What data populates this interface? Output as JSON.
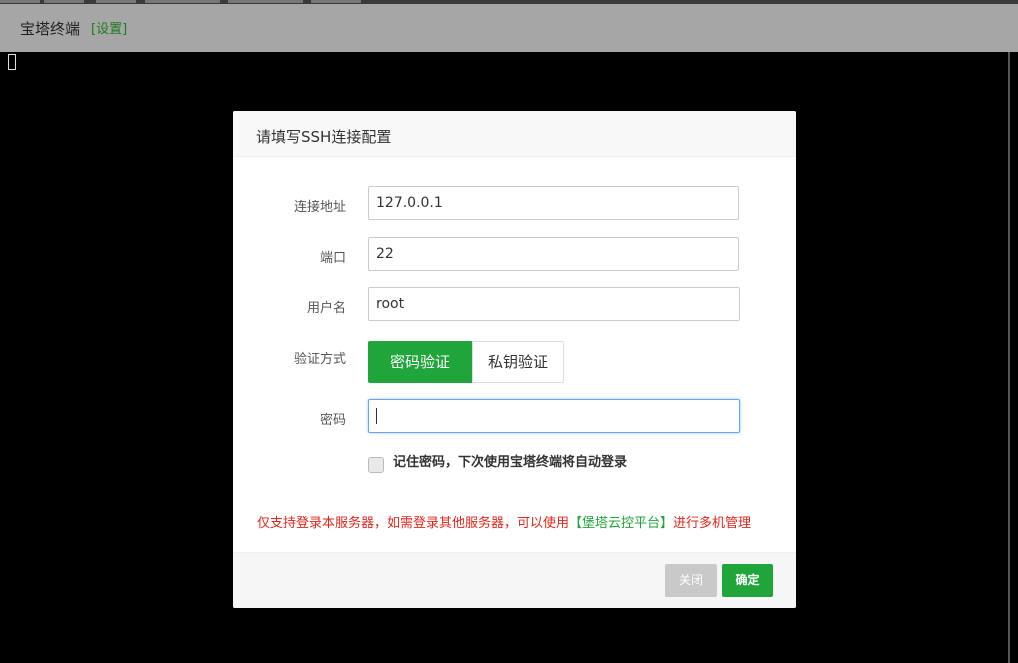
{
  "app": {
    "title": "宝塔终端",
    "settings_link": "[设置]"
  },
  "dialog": {
    "title": "请填写SSH连接配置",
    "fields": {
      "host": {
        "label": "连接地址",
        "value": "127.0.0.1"
      },
      "port": {
        "label": "端口",
        "value": "22"
      },
      "username": {
        "label": "用户名",
        "value": "root"
      },
      "auth_method": {
        "label": "验证方式",
        "options": [
          "密码验证",
          "私钥验证"
        ],
        "selected": "密码验证"
      },
      "password": {
        "label": "密码",
        "value": ""
      }
    },
    "remember": {
      "label": "记住密码，下次使用宝塔终端将自动登录",
      "checked": false
    },
    "notice": {
      "before": "仅支持登录本服务器，如需登录其他服务器，可以使用",
      "link": "【堡塔云控平台】",
      "after": "进行多机管理"
    },
    "buttons": {
      "close": "关闭",
      "confirm": "确定"
    }
  },
  "colors": {
    "accent": "#20a53a",
    "notice": "#e3261b",
    "titlebar_bg": "#a6a6a6",
    "terminal_bg": "#000000",
    "focus_border": "#66a5e8"
  }
}
